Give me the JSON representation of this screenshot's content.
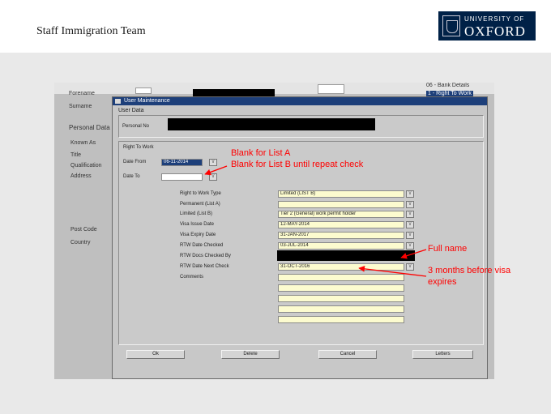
{
  "slide": {
    "title": "Staff Immigration Team"
  },
  "logo": {
    "university_of": "UNIVERSITY OF",
    "oxford": "OXFORD"
  },
  "background_form": {
    "labels": {
      "forename": "Forename",
      "surname": "Surname",
      "personal_data_tab": "Personal Data",
      "known_as": "Known As",
      "title": "Title",
      "qualification": "Qualification",
      "address": "Address",
      "post_code": "Post Code",
      "country": "Country"
    },
    "list_items": [
      "06 - Bank Details",
      "1 - Right To Work"
    ]
  },
  "dialog": {
    "title": "User Maintenance",
    "tab": "User Data",
    "personal_no_label": "Personal No",
    "rtw_section": "Right To Work",
    "date_from_label": "Date From",
    "date_from_value": "06-11-2014",
    "date_to_label": "Date To",
    "date_to_value": "",
    "lov_glyph": "\\/",
    "fields": [
      {
        "label": "Right to Work Type",
        "value": "Limited (LIST B)"
      },
      {
        "label": "Permanent (List A)",
        "value": ""
      },
      {
        "label": "Limited (List B)",
        "value": "Tier 2 (General) work permit holder"
      },
      {
        "label": "Visa Issue Date",
        "value": "12-MAY-2014"
      },
      {
        "label": "Visa Expiry Date",
        "value": "31-JAN-2017"
      },
      {
        "label": "RTW Date Checked",
        "value": "03-JUL-2014"
      },
      {
        "label": "RTW Docs Checked By",
        "value": ""
      },
      {
        "label": "RTW Date Next Check",
        "value": "31-OCT-2016"
      },
      {
        "label": "Comments",
        "value": ""
      }
    ],
    "buttons": {
      "ok": "Ok",
      "delete": "Delete",
      "cancel": "Cancel",
      "letters": "Letters"
    }
  },
  "annotations": {
    "blank_list_a": "Blank for List A",
    "blank_list_b": "Blank for List B until repeat check",
    "full_name": "Full name",
    "three_months_line1": "3 months before visa",
    "three_months_line2": "expires"
  },
  "colors": {
    "annotation": "#ff0000",
    "field_bg": "#fcfbcf",
    "title_bar": "#1d3f7a",
    "oxford_blue": "#002147"
  }
}
